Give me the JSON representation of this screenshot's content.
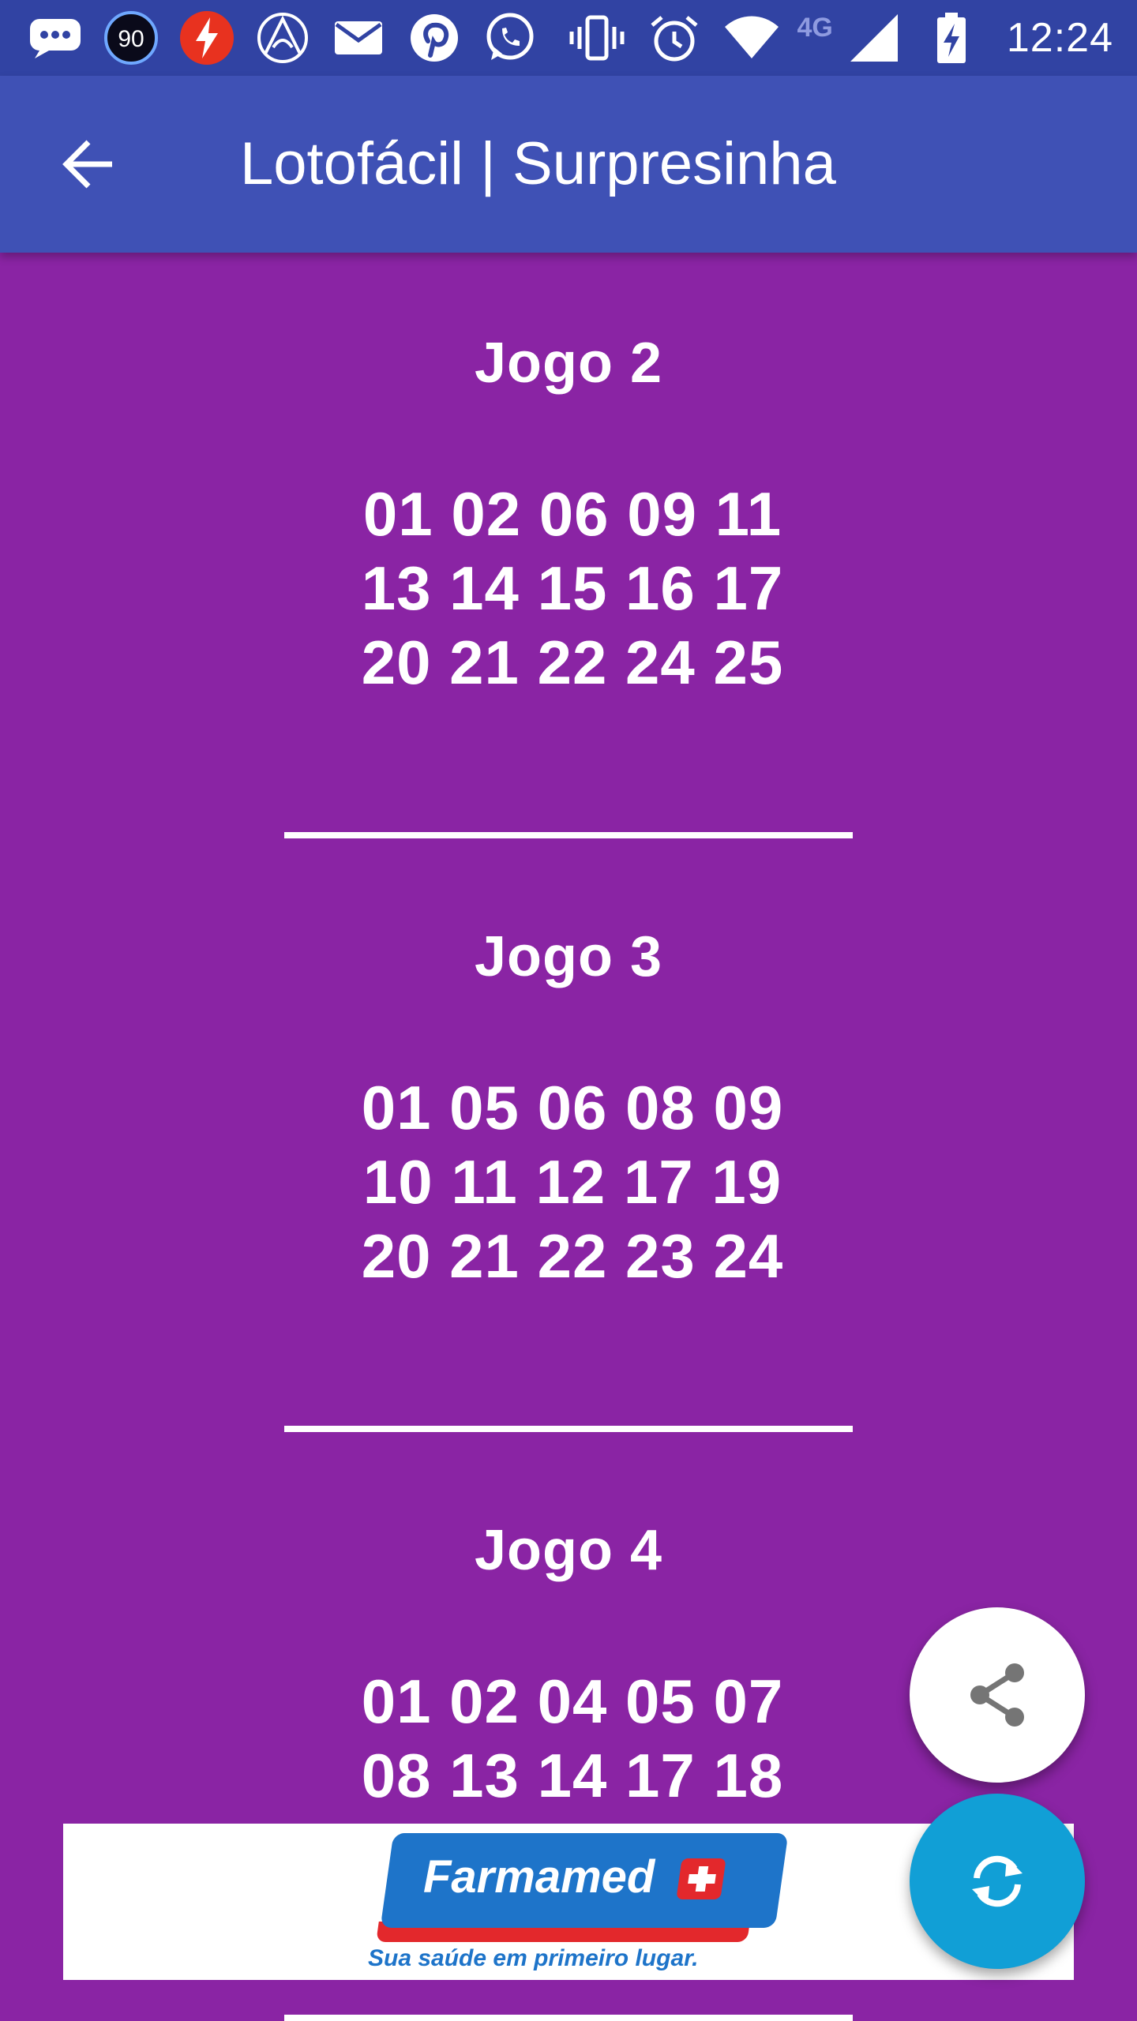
{
  "status_bar": {
    "time": "12:24",
    "network_label": "4G",
    "badge_number": "90",
    "icons_left": [
      "chat-bubble-icon",
      "counter-badge-icon",
      "flash-app-icon",
      "browser-icon",
      "mail-icon",
      "pinterest-icon",
      "whatsapp-icon"
    ],
    "icons_right": [
      "vibrate-icon",
      "alarm-icon",
      "wifi-icon",
      "cell-signal-icon",
      "battery-charging-icon"
    ]
  },
  "app_bar": {
    "title": "Lotofácil | Surpresinha",
    "back_icon": "arrow-back-icon"
  },
  "games": [
    {
      "title": "Jogo 2",
      "rows": [
        "01 02 06 09 11",
        "13 14 15 16 17",
        "20 21 22 24 25"
      ]
    },
    {
      "title": "Jogo 3",
      "rows": [
        "01 05 06 08 09",
        "10 11 12 17 19",
        "20 21 22 23 24"
      ]
    },
    {
      "title": "Jogo 4",
      "rows": [
        "01 02 04 05 07",
        "08 13 14 17 18"
      ]
    }
  ],
  "ad": {
    "brand": "Farmamed",
    "slogan": "Sua saúde em primeiro lugar."
  },
  "fabs": {
    "share_icon": "share-icon",
    "refresh_icon": "refresh-icon"
  },
  "colors": {
    "status_bar": "#3143a3",
    "app_bar": "#3f51b5",
    "background": "#8a24a4",
    "fab_refresh": "#119fd6",
    "fab_share": "#ffffff",
    "ad_blue": "#1e74c9",
    "ad_red": "#e3282c"
  }
}
